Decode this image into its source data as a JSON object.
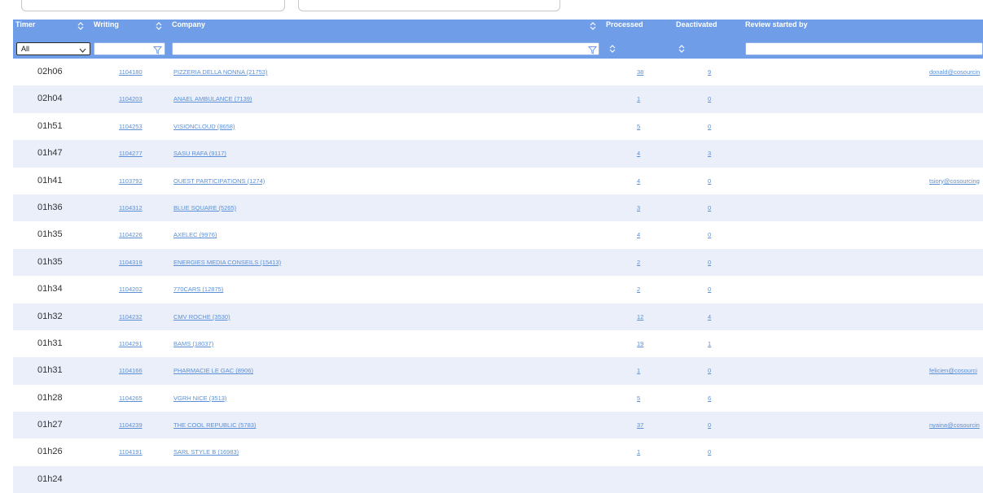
{
  "top_filters": {
    "field1_placeholder": "...",
    "field2_placeholder": "..."
  },
  "header": {
    "timer": "Timer",
    "writing": "Writing",
    "company": "Company",
    "processed": "Processed",
    "deactivated": "Deactivated",
    "review_started_by": "Review started by",
    "timer_filter_value": "All"
  },
  "rows": [
    {
      "timer": "02h06",
      "writing": "1104180",
      "company": "PIZZERIA DELLA NONNA (21753)",
      "processed": "38",
      "deactivated": "9",
      "reviewer": "donald@cosourcin"
    },
    {
      "timer": "02h04",
      "writing": "1104203",
      "company": "ANAEL AMBULANCE (7139)",
      "processed": "1",
      "deactivated": "0",
      "reviewer": ""
    },
    {
      "timer": "01h51",
      "writing": "1104253",
      "company": "VISIONCLOUD (8658)",
      "processed": "5",
      "deactivated": "0",
      "reviewer": ""
    },
    {
      "timer": "01h47",
      "writing": "1104277",
      "company": "SASU RAFA (9117)",
      "processed": "4",
      "deactivated": "3",
      "reviewer": ""
    },
    {
      "timer": "01h41",
      "writing": "1103792",
      "company": "OUEST PARTICIPATIONS (1274)",
      "processed": "4",
      "deactivated": "0",
      "reviewer": "tsiory@cosourcing"
    },
    {
      "timer": "01h36",
      "writing": "1104312",
      "company": "BLUE SQUARE (5265)",
      "processed": "3",
      "deactivated": "0",
      "reviewer": ""
    },
    {
      "timer": "01h35",
      "writing": "1104226",
      "company": "AXELEC (9976)",
      "processed": "4",
      "deactivated": "0",
      "reviewer": ""
    },
    {
      "timer": "01h35",
      "writing": "1104319",
      "company": "ENERGIES MEDIA CONSEILS (15413)",
      "processed": "2",
      "deactivated": "0",
      "reviewer": ""
    },
    {
      "timer": "01h34",
      "writing": "1104202",
      "company": "770CARS (12875)",
      "processed": "2",
      "deactivated": "0",
      "reviewer": ""
    },
    {
      "timer": "01h32",
      "writing": "1104232",
      "company": "CMV ROCHE (3530)",
      "processed": "12",
      "deactivated": "4",
      "reviewer": ""
    },
    {
      "timer": "01h31",
      "writing": "1104291",
      "company": "BAMS (18037)",
      "processed": "19",
      "deactivated": "1",
      "reviewer": ""
    },
    {
      "timer": "01h31",
      "writing": "1104166",
      "company": "PHARMACIE LE GAC (8906)",
      "processed": "1",
      "deactivated": "0",
      "reviewer": "felicien@cosourci"
    },
    {
      "timer": "01h28",
      "writing": "1104265",
      "company": "VGRH NICE (3513)",
      "processed": "5",
      "deactivated": "6",
      "reviewer": ""
    },
    {
      "timer": "01h27",
      "writing": "1104239",
      "company": "THE COOL REPUBLIC (5783)",
      "processed": "37",
      "deactivated": "0",
      "reviewer": "nyaina@cosourcin"
    },
    {
      "timer": "01h26",
      "writing": "1104191",
      "company": "SARL STYLE B (16983)",
      "processed": "1",
      "deactivated": "0",
      "reviewer": ""
    },
    {
      "timer": "01h24",
      "writing": "",
      "company": "",
      "processed": "",
      "deactivated": "",
      "reviewer": ""
    }
  ]
}
